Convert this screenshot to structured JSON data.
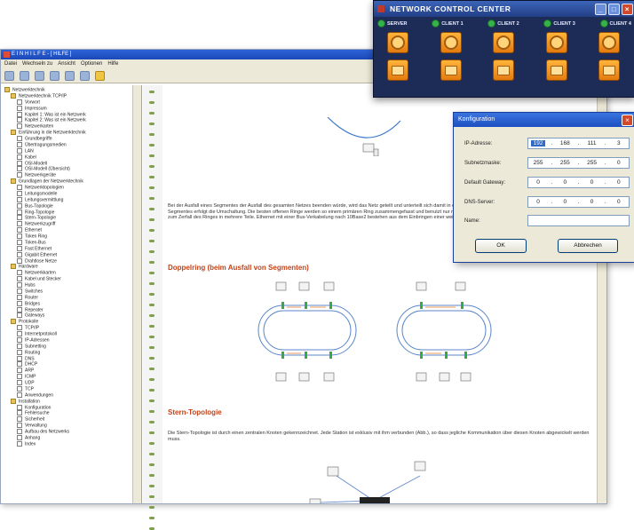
{
  "help": {
    "title": "E I N  H I L F E  -  [  HILFE  ]",
    "menu": [
      "Datei",
      "Wechseln zu",
      "Ansicht",
      "Optionen",
      "Hilfe"
    ],
    "tree": [
      "Netzwerktechnik",
      "Netzwerktechnik TCP/IP",
      "Vorwort",
      "Impressum",
      "Kapitel 1: Was ist ein Netzwerk",
      "Kapitel 2: Was ist ein Netzwerk",
      "Netzwerkarten",
      "Einführung in die Netzwerktechnik",
      "Grundbegriffe",
      "Übertragungsmedien",
      "LAN",
      "Kabel",
      "OSI-Modell",
      "OSI-Modell (Übersicht)",
      "Netzwerkgeräte",
      "Grundlagen der Netzwerktechnik",
      "Netzwerktopologien",
      "Leitungsmodelle",
      "Leitungsvermittlung",
      "Bus-Topologie",
      "Ring-Topologie",
      "Stern-Topologie",
      "Netzwerkzugriff",
      "Ethernet",
      "Token Ring",
      "Token-Bus",
      "Fast Ethernet",
      "Gigabit Ethernet",
      "Drahtlose Netze",
      "Hardware",
      "Netzwerkkarten",
      "Kabel und Stecker",
      "Hubs",
      "Switches",
      "Router",
      "Bridges",
      "Repeater",
      "Gateways",
      "Protokolle",
      "TCP/IP",
      "Internetprotokoll",
      "IP-Adressen",
      "Subnetting",
      "Routing",
      "DNS",
      "DHCP",
      "ARP",
      "ICMP",
      "UDP",
      "TCP",
      "Anwendungen",
      "Installation",
      "Konfiguration",
      "Fehlersuche",
      "Sicherheit",
      "Verwaltung",
      "Aufbau des Netzwerks",
      "Anhang",
      "Index"
    ],
    "paragraph1": "Bei der Ausfall eines Segmentes der Ausfall des gesamten Netzes beenden würde, wird das Netz geteilt und unterteilt sich damit in einen primären und einen sekundären Ring. Bei Ausfall eines Segmentes erfolgt die Umschaltung. Die besten offenen Ringe werden so einem primären Ring zusammengefasst und benutzt nur mit halber Bandbreite. Jede Ein weiterer Segmentausfall führt zum Zerfall des Ringes in mehrere Teile. Ethernet mit einer Bus-Verkabelung nach 10Base2 bestehen aus dem Einbringen einer weiteren Kabelverbindung.",
    "heading1": "Doppelring (beim Ausfall von Segmenten)",
    "heading2": "Stern-Topologie",
    "paragraph2": "Die Stern-Topologie ist durch einen zentralen Knoten gekennzeichnet. Jede Station ist exklusiv mit ihm verbunden (Abb.), so dass jegliche Kommunikation über diesen Knoten abgewickelt werden muss."
  },
  "ncc": {
    "title": "NETWORK CONTROL CENTER",
    "labels": [
      "SERVER",
      "CLIENT 1",
      "CLIENT 2",
      "CLIENT 3",
      "CLIENT 4"
    ]
  },
  "konfig": {
    "title": "Konfiguration",
    "ip_label": "IP-Adresse:",
    "ip": [
      "192",
      "168",
      "111",
      "3"
    ],
    "subnet_label": "Subnetzmaske:",
    "subnet": [
      "255",
      "255",
      "255",
      "0"
    ],
    "gateway_label": "Default Gateway:",
    "gateway": [
      "0",
      "0",
      "0",
      "0"
    ],
    "dns_label": "DNS-Server:",
    "dns": [
      "0",
      "0",
      "0",
      "0"
    ],
    "name_label": "Name:",
    "name_value": "",
    "ok_label": "OK",
    "cancel_label": "Abbrechen"
  }
}
